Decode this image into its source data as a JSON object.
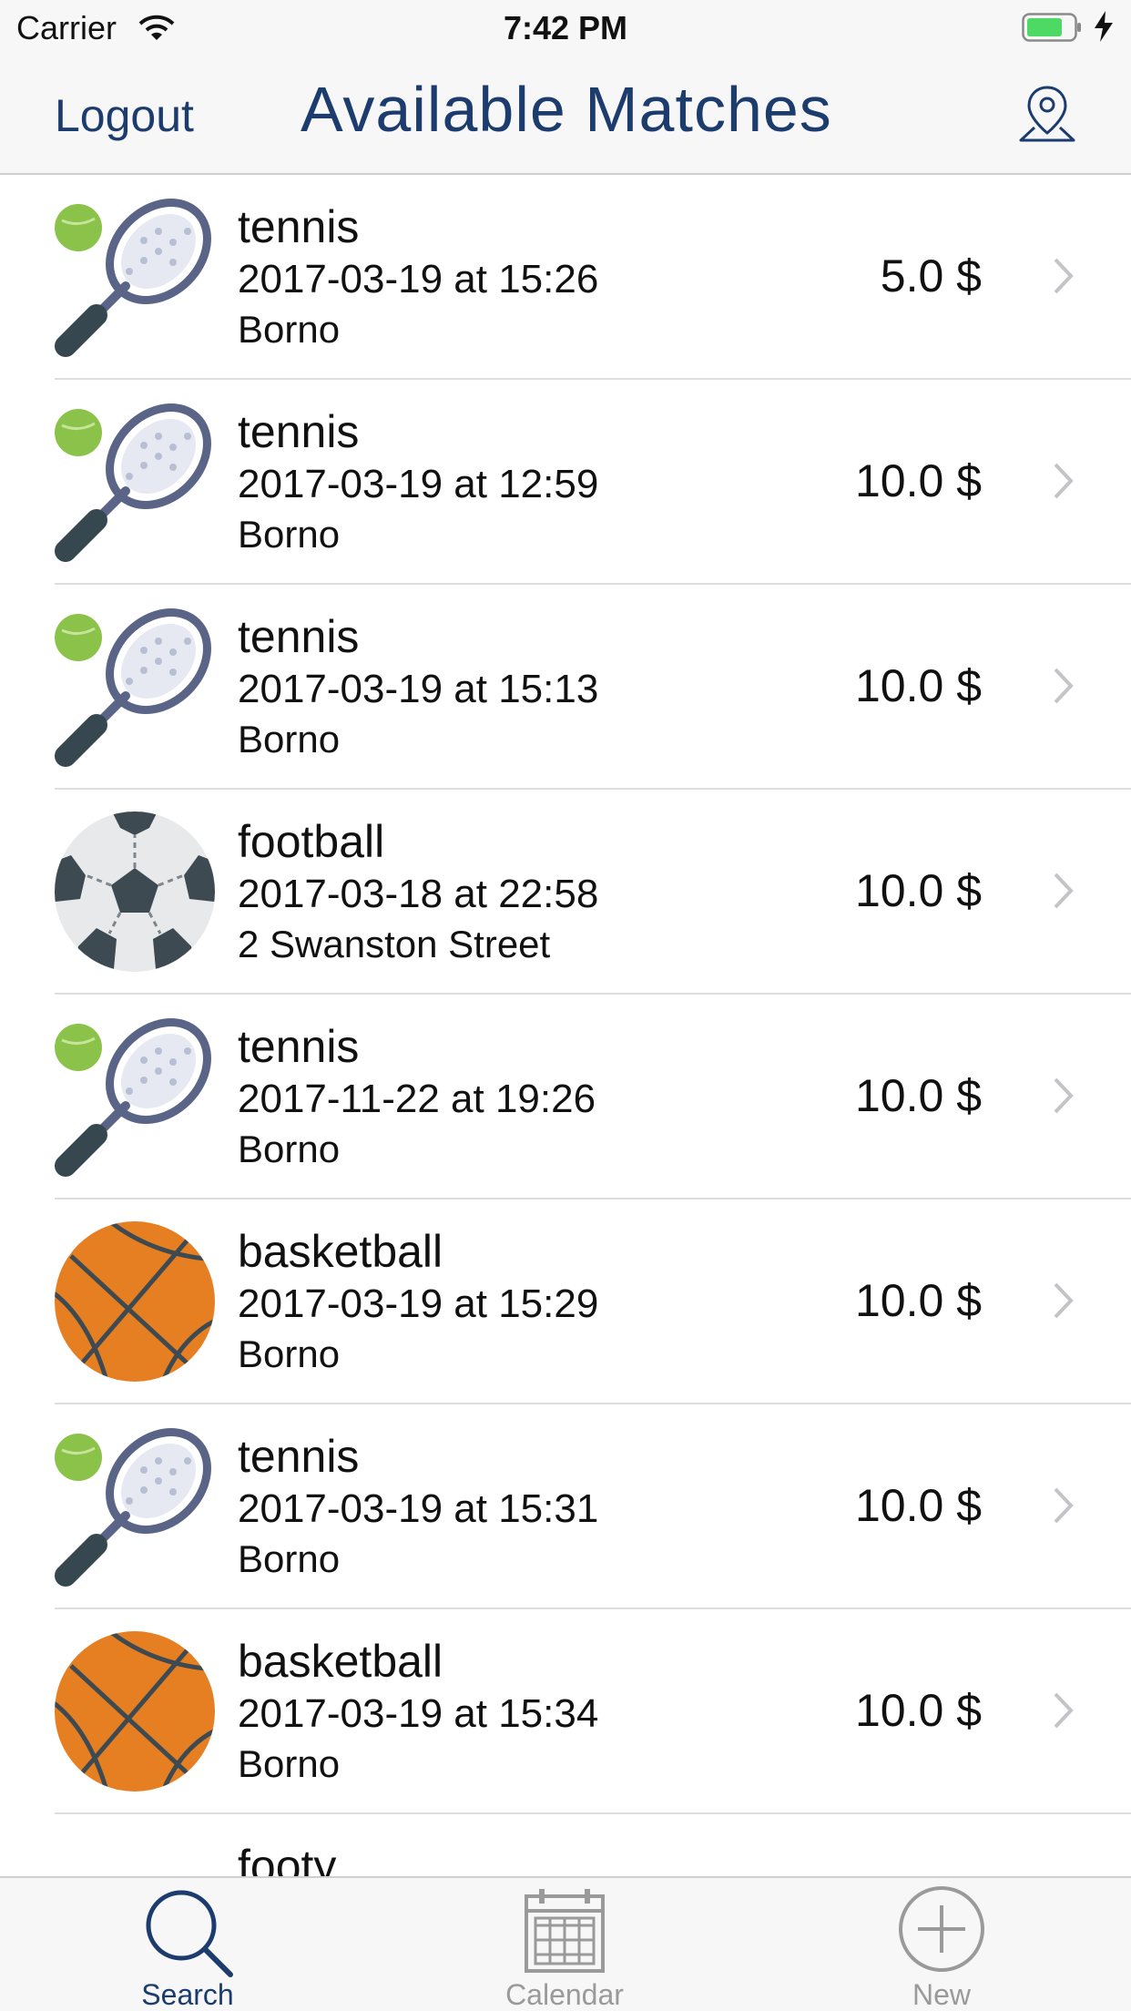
{
  "status_bar": {
    "carrier": "Carrier",
    "time": "7:42 PM"
  },
  "nav": {
    "logout_label": "Logout",
    "title": "Available Matches",
    "map_icon": "location-pin-icon"
  },
  "colors": {
    "accent": "#1d3c6e",
    "tab_active": "#1d3c6e",
    "tab_inactive": "#9a9a9a",
    "basketball": "#e67e22",
    "tennis_ball": "#8bc34a"
  },
  "matches": [
    {
      "sport": "tennis",
      "datetime": "2017-03-19 at 15:26",
      "location": "Borno",
      "price": "5.0 $",
      "icon": "tennis-icon"
    },
    {
      "sport": "tennis",
      "datetime": "2017-03-19 at 12:59",
      "location": "Borno",
      "price": "10.0 $",
      "icon": "tennis-icon"
    },
    {
      "sport": "tennis",
      "datetime": "2017-03-19 at 15:13",
      "location": "Borno",
      "price": "10.0 $",
      "icon": "tennis-icon"
    },
    {
      "sport": "football",
      "datetime": "2017-03-18 at 22:58",
      "location": "2 Swanston Street",
      "price": "10.0 $",
      "icon": "football-icon"
    },
    {
      "sport": "tennis",
      "datetime": "2017-11-22 at 19:26",
      "location": "Borno",
      "price": "10.0 $",
      "icon": "tennis-icon"
    },
    {
      "sport": "basketball",
      "datetime": "2017-03-19 at 15:29",
      "location": "Borno",
      "price": "10.0 $",
      "icon": "basketball-icon"
    },
    {
      "sport": "tennis",
      "datetime": "2017-03-19 at 15:31",
      "location": "Borno",
      "price": "10.0 $",
      "icon": "tennis-icon"
    },
    {
      "sport": "basketball",
      "datetime": "2017-03-19 at 15:34",
      "location": "Borno",
      "price": "10.0 $",
      "icon": "basketball-icon"
    },
    {
      "sport": "footy"
    }
  ],
  "tabs": [
    {
      "label": "Search",
      "icon": "search-icon",
      "active": true
    },
    {
      "label": "Calendar",
      "icon": "calendar-icon",
      "active": false
    },
    {
      "label": "New",
      "icon": "plus-circle-icon",
      "active": false
    }
  ]
}
